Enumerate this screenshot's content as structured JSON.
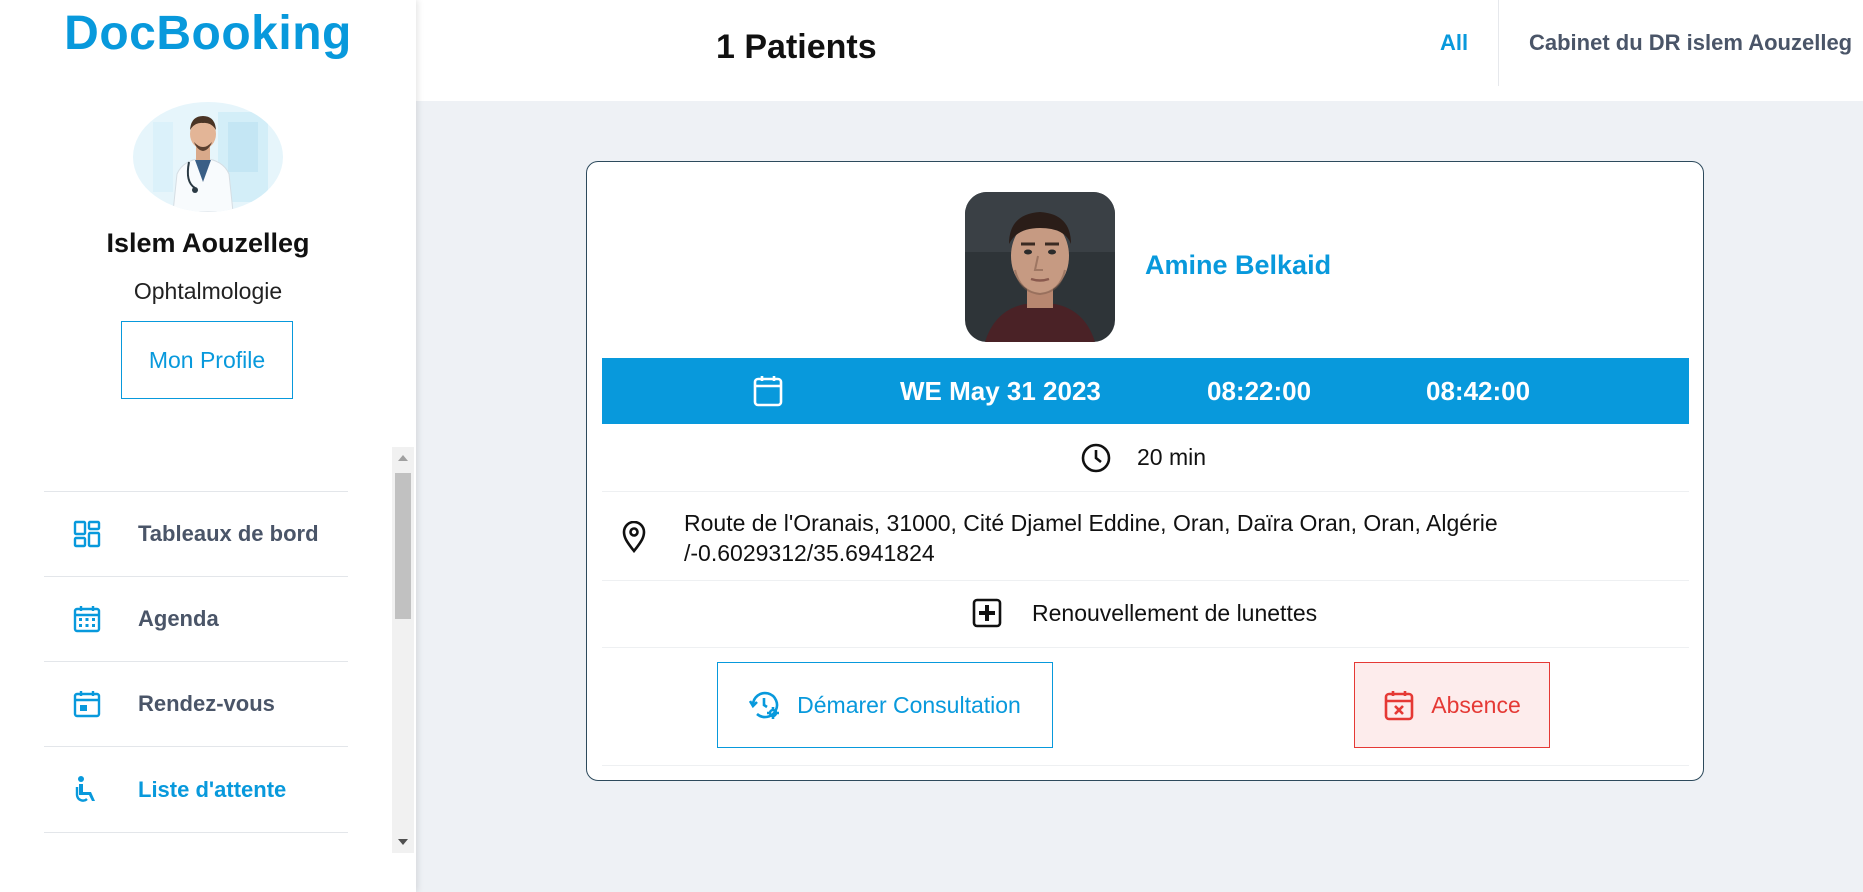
{
  "sidebar": {
    "brand": "DocBooking",
    "doctor": {
      "name": "Islem Aouzelleg",
      "specialty": "Ophtalmologie",
      "profile_button": "Mon Profile"
    },
    "nav": [
      {
        "label": "Tableaux de bord",
        "icon": "dashboard-icon"
      },
      {
        "label": "Agenda",
        "icon": "calendar-grid-icon"
      },
      {
        "label": "Rendez-vous",
        "icon": "calendar-event-icon"
      },
      {
        "label": "Liste d'attente",
        "icon": "wheelchair-icon",
        "active": true
      }
    ]
  },
  "header": {
    "title": "1 Patients",
    "filter": "All",
    "clinic": "Cabinet du DR islem Aouzelleg"
  },
  "appointment": {
    "patient_name": "Amine Belkaid",
    "date": "WE May 31 2023",
    "start_time": "08:22:00",
    "end_time": "08:42:00",
    "duration": "20 min",
    "address_line1": "Route de l'Oranais, 31000, Cité Djamel Eddine, Oran, Daïra Oran, Oran, Algérie",
    "address_line2": "/-0.6029312/35.6941824",
    "reason": "Renouvellement de lunettes",
    "start_button": "Démarer Consultation",
    "absence_button": "Absence"
  },
  "colors": {
    "accent": "#0899dc",
    "danger": "#e53935",
    "danger_bg": "#fdecec",
    "nav_text": "#4a5568",
    "background": "#eef1f5"
  }
}
